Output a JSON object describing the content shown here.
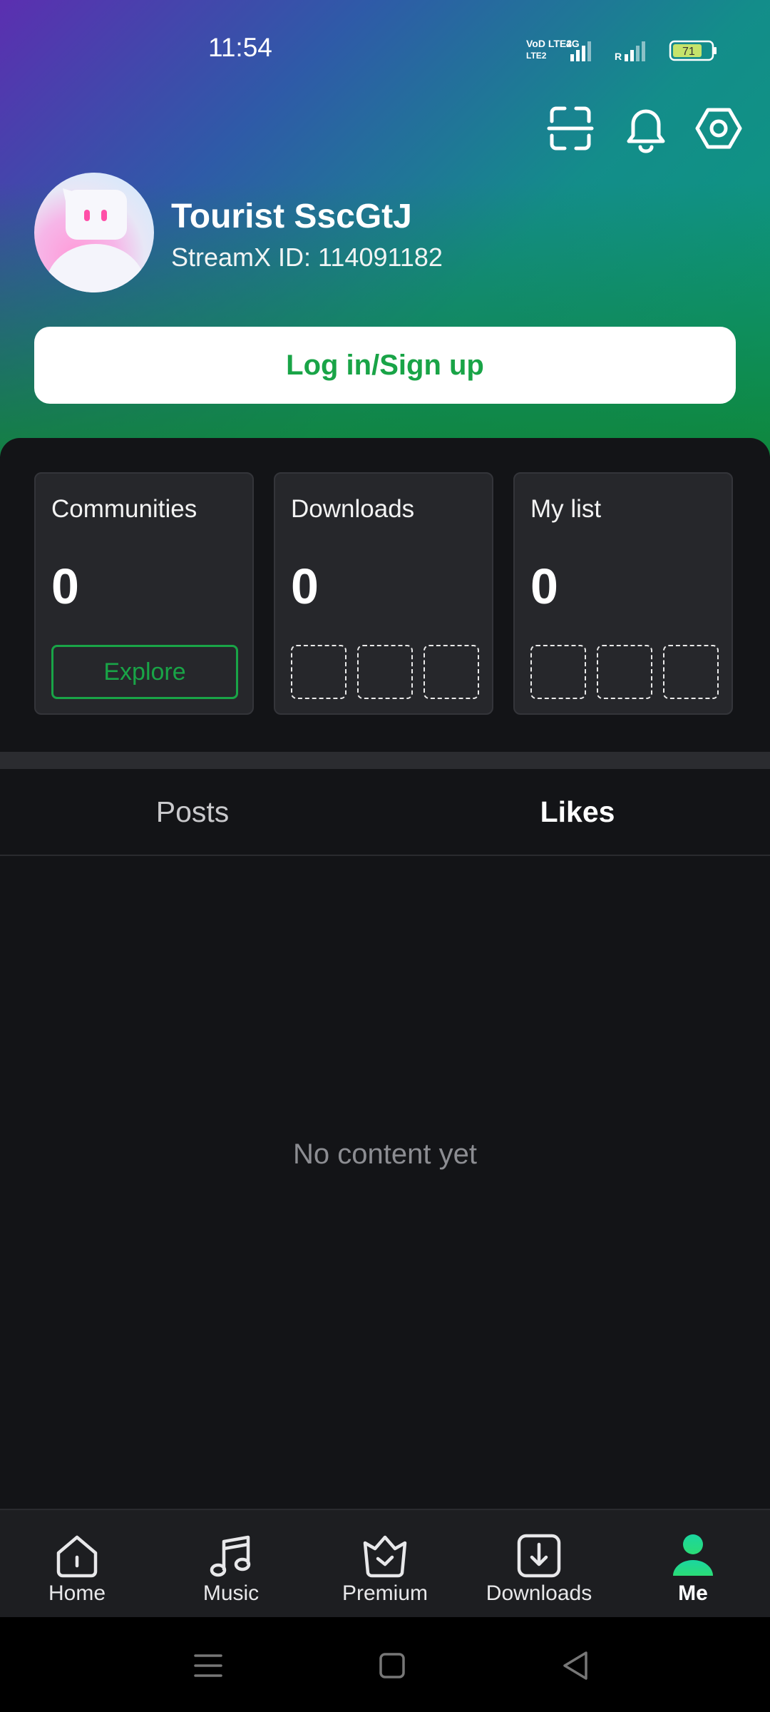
{
  "status_bar": {
    "time": "11:54",
    "network_label": "VoD LTE2",
    "network_type": "4G",
    "roaming_label": "R",
    "battery_level": "71"
  },
  "header_actions": {
    "scan_icon": "scan-icon",
    "bell_icon": "bell-icon",
    "settings_icon": "hexagon-settings-icon"
  },
  "profile": {
    "name": "Tourist SscGtJ",
    "id_text": "StreamX ID: 114091182",
    "avatar_icon": "robot-avatar"
  },
  "login_button": {
    "label": "Log in/Sign up"
  },
  "cards": [
    {
      "title": "Communities",
      "count": "0",
      "action_label": "Explore"
    },
    {
      "title": "Downloads",
      "count": "0"
    },
    {
      "title": "My list",
      "count": "0"
    }
  ],
  "tabs": [
    {
      "label": "Posts",
      "active": false
    },
    {
      "label": "Likes",
      "active": true
    }
  ],
  "empty_state": {
    "text": "No content yet"
  },
  "bottom_nav": [
    {
      "label": "Home",
      "icon": "home-icon"
    },
    {
      "label": "Music",
      "icon": "music-note-icon"
    },
    {
      "label": "Premium",
      "icon": "crown-icon"
    },
    {
      "label": "Downloads",
      "icon": "download-icon"
    },
    {
      "label": "Me",
      "icon": "person-icon",
      "active": true
    }
  ],
  "colors": {
    "accent_green": "#19a447",
    "background": "#131417",
    "card": "#26272b",
    "me_icon_gradient": [
      "#1bd6a0",
      "#2bdc76"
    ]
  },
  "system_nav": {
    "icons": [
      "menu-icon",
      "home-square-icon",
      "back-triangle-icon"
    ]
  }
}
